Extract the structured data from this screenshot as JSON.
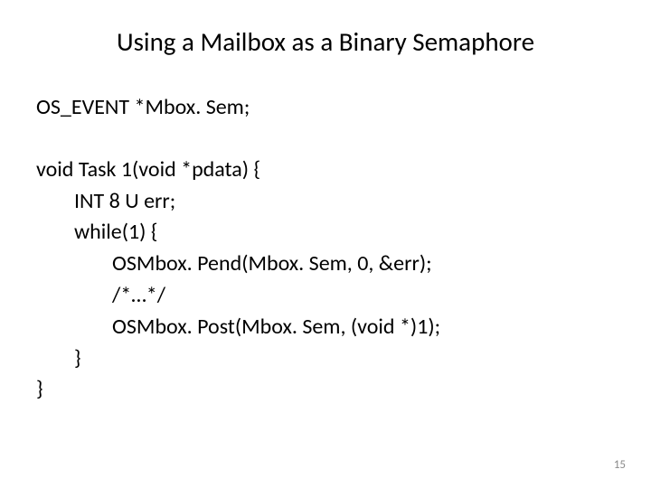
{
  "slide": {
    "title": "Using a Mailbox as a Binary Semaphore",
    "lines": [
      {
        "text": "OS_EVENT *Mbox. Sem;",
        "indent": 0
      },
      {
        "text": "",
        "indent": 0,
        "blank": true
      },
      {
        "text": "void Task 1(void *pdata) {",
        "indent": 0
      },
      {
        "text": "INT 8 U err;",
        "indent": 1
      },
      {
        "text": "while(1) {",
        "indent": 1
      },
      {
        "text": "OSMbox. Pend(Mbox. Sem, 0, &err);",
        "indent": 2
      },
      {
        "text": "/*…*/",
        "indent": 2
      },
      {
        "text": "OSMbox. Post(Mbox. Sem, (void *)1);",
        "indent": 2
      },
      {
        "text": "}",
        "indent": 1
      },
      {
        "text": "}",
        "indent": 0
      }
    ],
    "page_number": "15"
  }
}
